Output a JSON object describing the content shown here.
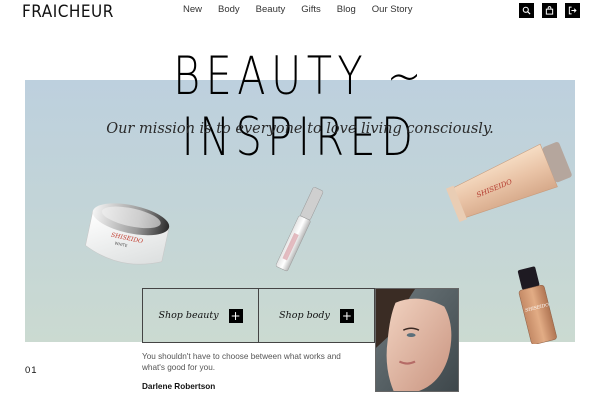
{
  "brand": "FRAICHEUR",
  "nav": [
    "New",
    "Body",
    "Beauty",
    "Gifts",
    "Blog",
    "Our Story"
  ],
  "header_icons": [
    "search-icon",
    "bag-icon",
    "logout-icon"
  ],
  "hero": {
    "title": "BEAUTY ~ INSPIRED",
    "mission": "Our mission is to everyone to love living consciously."
  },
  "cta": {
    "beauty": "Shop beauty",
    "body": "Shop body",
    "plus": "+"
  },
  "products": {
    "cream_brand": "SHISEIDO",
    "cream_line": "WHITE",
    "tube_brand": "SHISEIDO",
    "bottle_brand": "SHISEIDO"
  },
  "testimonial": {
    "index": "01",
    "quote": "You shouldn't have to choose between what works and what's good for you.",
    "author": "Darlene Robertson"
  },
  "colors": {
    "hero_top": "#bdd0de",
    "hero_bottom": "#cbdad1",
    "accent": "#000000"
  }
}
